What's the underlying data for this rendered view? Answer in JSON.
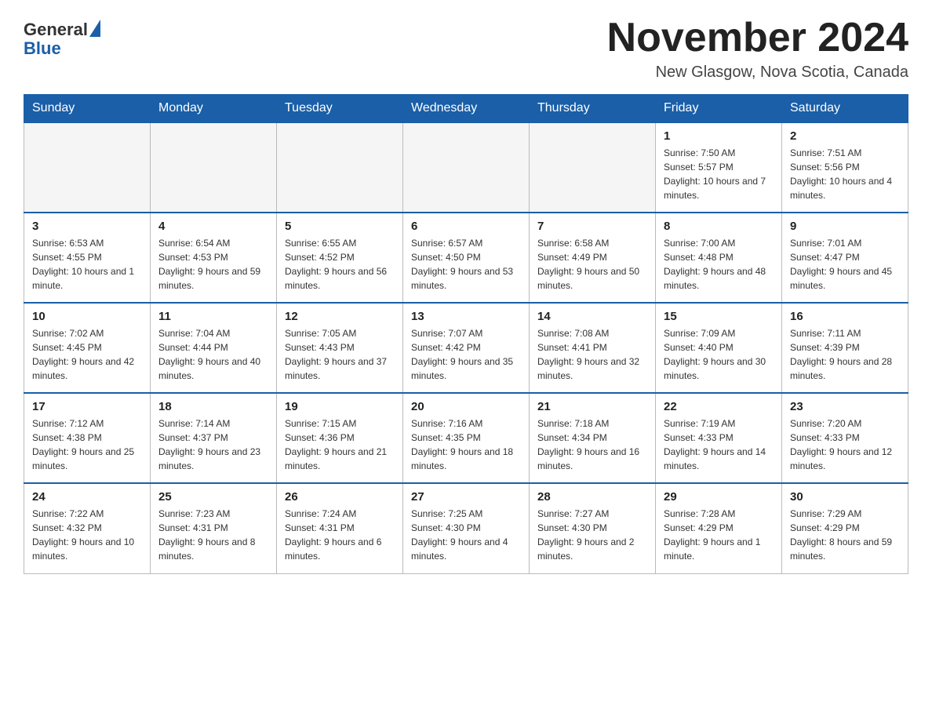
{
  "header": {
    "logo_general": "General",
    "logo_blue": "Blue",
    "month_title": "November 2024",
    "location": "New Glasgow, Nova Scotia, Canada"
  },
  "weekdays": [
    "Sunday",
    "Monday",
    "Tuesday",
    "Wednesday",
    "Thursday",
    "Friday",
    "Saturday"
  ],
  "weeks": [
    [
      {
        "day": "",
        "info": ""
      },
      {
        "day": "",
        "info": ""
      },
      {
        "day": "",
        "info": ""
      },
      {
        "day": "",
        "info": ""
      },
      {
        "day": "",
        "info": ""
      },
      {
        "day": "1",
        "info": "Sunrise: 7:50 AM\nSunset: 5:57 PM\nDaylight: 10 hours and 7 minutes."
      },
      {
        "day": "2",
        "info": "Sunrise: 7:51 AM\nSunset: 5:56 PM\nDaylight: 10 hours and 4 minutes."
      }
    ],
    [
      {
        "day": "3",
        "info": "Sunrise: 6:53 AM\nSunset: 4:55 PM\nDaylight: 10 hours and 1 minute."
      },
      {
        "day": "4",
        "info": "Sunrise: 6:54 AM\nSunset: 4:53 PM\nDaylight: 9 hours and 59 minutes."
      },
      {
        "day": "5",
        "info": "Sunrise: 6:55 AM\nSunset: 4:52 PM\nDaylight: 9 hours and 56 minutes."
      },
      {
        "day": "6",
        "info": "Sunrise: 6:57 AM\nSunset: 4:50 PM\nDaylight: 9 hours and 53 minutes."
      },
      {
        "day": "7",
        "info": "Sunrise: 6:58 AM\nSunset: 4:49 PM\nDaylight: 9 hours and 50 minutes."
      },
      {
        "day": "8",
        "info": "Sunrise: 7:00 AM\nSunset: 4:48 PM\nDaylight: 9 hours and 48 minutes."
      },
      {
        "day": "9",
        "info": "Sunrise: 7:01 AM\nSunset: 4:47 PM\nDaylight: 9 hours and 45 minutes."
      }
    ],
    [
      {
        "day": "10",
        "info": "Sunrise: 7:02 AM\nSunset: 4:45 PM\nDaylight: 9 hours and 42 minutes."
      },
      {
        "day": "11",
        "info": "Sunrise: 7:04 AM\nSunset: 4:44 PM\nDaylight: 9 hours and 40 minutes."
      },
      {
        "day": "12",
        "info": "Sunrise: 7:05 AM\nSunset: 4:43 PM\nDaylight: 9 hours and 37 minutes."
      },
      {
        "day": "13",
        "info": "Sunrise: 7:07 AM\nSunset: 4:42 PM\nDaylight: 9 hours and 35 minutes."
      },
      {
        "day": "14",
        "info": "Sunrise: 7:08 AM\nSunset: 4:41 PM\nDaylight: 9 hours and 32 minutes."
      },
      {
        "day": "15",
        "info": "Sunrise: 7:09 AM\nSunset: 4:40 PM\nDaylight: 9 hours and 30 minutes."
      },
      {
        "day": "16",
        "info": "Sunrise: 7:11 AM\nSunset: 4:39 PM\nDaylight: 9 hours and 28 minutes."
      }
    ],
    [
      {
        "day": "17",
        "info": "Sunrise: 7:12 AM\nSunset: 4:38 PM\nDaylight: 9 hours and 25 minutes."
      },
      {
        "day": "18",
        "info": "Sunrise: 7:14 AM\nSunset: 4:37 PM\nDaylight: 9 hours and 23 minutes."
      },
      {
        "day": "19",
        "info": "Sunrise: 7:15 AM\nSunset: 4:36 PM\nDaylight: 9 hours and 21 minutes."
      },
      {
        "day": "20",
        "info": "Sunrise: 7:16 AM\nSunset: 4:35 PM\nDaylight: 9 hours and 18 minutes."
      },
      {
        "day": "21",
        "info": "Sunrise: 7:18 AM\nSunset: 4:34 PM\nDaylight: 9 hours and 16 minutes."
      },
      {
        "day": "22",
        "info": "Sunrise: 7:19 AM\nSunset: 4:33 PM\nDaylight: 9 hours and 14 minutes."
      },
      {
        "day": "23",
        "info": "Sunrise: 7:20 AM\nSunset: 4:33 PM\nDaylight: 9 hours and 12 minutes."
      }
    ],
    [
      {
        "day": "24",
        "info": "Sunrise: 7:22 AM\nSunset: 4:32 PM\nDaylight: 9 hours and 10 minutes."
      },
      {
        "day": "25",
        "info": "Sunrise: 7:23 AM\nSunset: 4:31 PM\nDaylight: 9 hours and 8 minutes."
      },
      {
        "day": "26",
        "info": "Sunrise: 7:24 AM\nSunset: 4:31 PM\nDaylight: 9 hours and 6 minutes."
      },
      {
        "day": "27",
        "info": "Sunrise: 7:25 AM\nSunset: 4:30 PM\nDaylight: 9 hours and 4 minutes."
      },
      {
        "day": "28",
        "info": "Sunrise: 7:27 AM\nSunset: 4:30 PM\nDaylight: 9 hours and 2 minutes."
      },
      {
        "day": "29",
        "info": "Sunrise: 7:28 AM\nSunset: 4:29 PM\nDaylight: 9 hours and 1 minute."
      },
      {
        "day": "30",
        "info": "Sunrise: 7:29 AM\nSunset: 4:29 PM\nDaylight: 8 hours and 59 minutes."
      }
    ]
  ]
}
